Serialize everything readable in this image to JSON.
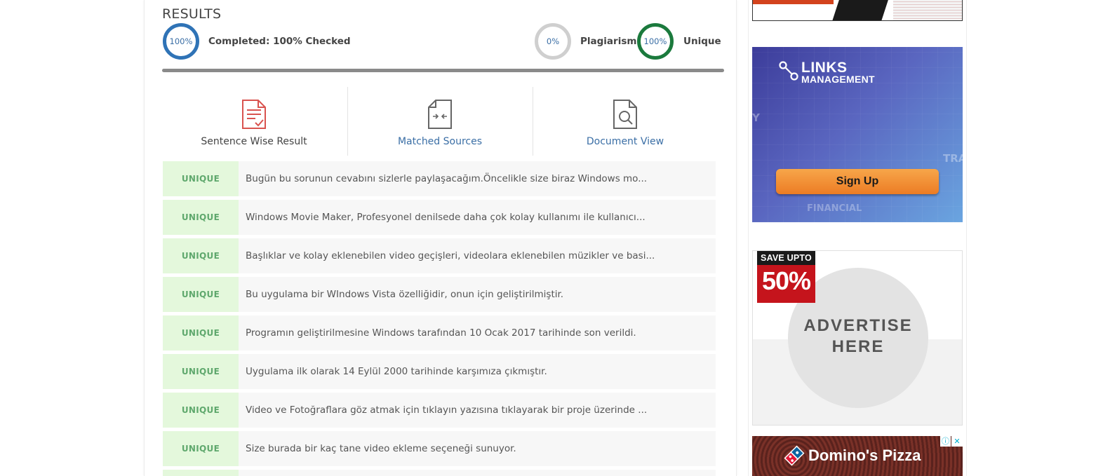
{
  "results": {
    "title": "RESULTS",
    "completed_percent": "100%",
    "completed_label": "Completed: 100% Checked",
    "plagiarism_percent": "0%",
    "plagiarism_label": "Plagiarism",
    "unique_percent": "100%",
    "unique_label": "Unique",
    "progress": 1.0
  },
  "tabs": [
    {
      "label": "Sentence Wise Result",
      "icon": "document-check-icon",
      "color": "#444444"
    },
    {
      "label": "Matched Sources",
      "icon": "document-compare-icon",
      "color": "#3a6ea5"
    },
    {
      "label": "Document View",
      "icon": "document-search-icon",
      "color": "#3a6ea5"
    }
  ],
  "rows": [
    {
      "status": "UNIQUE",
      "text": "Bugün bu sorunun cevabını sizlerle paylaşacağım.Öncelikle size biraz Windows mo..."
    },
    {
      "status": "UNIQUE",
      "text": "Windows Movie Maker, Profesyonel denilsede daha çok kolay kullanımı ile kullanıcı..."
    },
    {
      "status": "UNIQUE",
      "text": "Başlıklar ve kolay eklenebilen video geçişleri, videolara eklenebilen müzikler ve basi..."
    },
    {
      "status": "UNIQUE",
      "text": "Bu uygulama bir WIndows Vista özelliğidir, onun için geliştirilmiştir."
    },
    {
      "status": "UNIQUE",
      "text": "Programın geliştirilmesine Windows tarafından 10 Ocak 2017 tarihinde son verildi."
    },
    {
      "status": "UNIQUE",
      "text": "Uygulama ilk olarak 14 Eylül 2000 tarihinde karşımıza çıkmıştır."
    },
    {
      "status": "UNIQUE",
      "text": "Video ve Fotoğraflara göz atmak için tıklayın yazısına tıklayarak bir proje üzerinde ..."
    },
    {
      "status": "UNIQUE",
      "text": "Size burada bir kaç tane video ekleme seçeneği sunuyor."
    }
  ],
  "ads": {
    "links": {
      "brand_line1": "LINKS",
      "brand_line2": "MANAGEMENT",
      "button": "Sign Up",
      "bg_text1": "TRA",
      "bg_text2": "FINANCIAL",
      "bg_text3": "Y"
    },
    "save": {
      "top": "SAVE UPTO",
      "percent": "50%",
      "line1": "ADVERTISE",
      "line2": "HERE"
    },
    "dominos": {
      "brand": "Domino's Pizza",
      "info": "ⓘ",
      "close": "✕"
    }
  },
  "colors": {
    "complete_ring": "#2f73b6",
    "plagiarism_ring": "#cfcfcf",
    "unique_ring": "#1b7a3d",
    "unique_badge_bg": "#e4f8dc",
    "unique_badge_text": "#5fa86d",
    "link_blue": "#3a6ea5"
  }
}
